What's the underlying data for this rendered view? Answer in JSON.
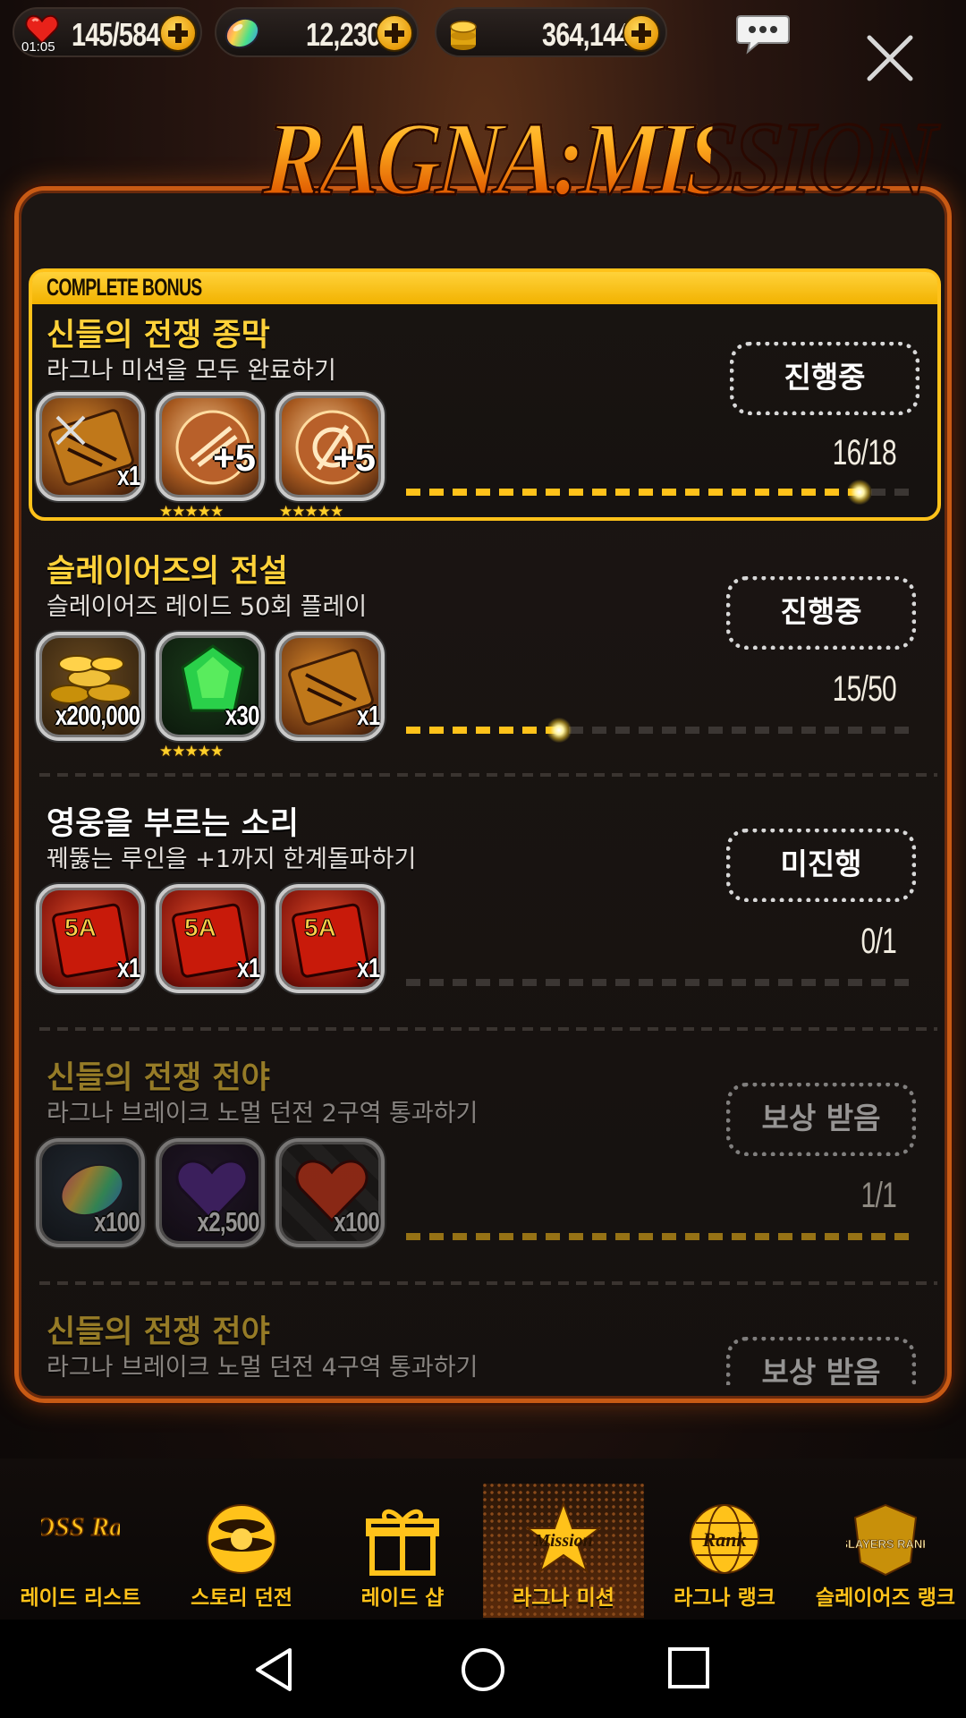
{
  "topbar": {
    "stamina": "145/584",
    "stamina_timer": "01:05",
    "gems": "12,230",
    "gold": "364,144"
  },
  "title": "Ragna:Mission",
  "complete_bonus_label": "COMPLETE BONUS",
  "missions": [
    {
      "title": "신들의 전쟁 종막",
      "desc": "라그나 미션을 모두 완료하기",
      "status": "진행중",
      "progress_text": "16/18",
      "progress": 0.889,
      "rewards": [
        {
          "icon": "ticket-icon",
          "qty": "x1"
        },
        {
          "icon": "rune-orb-icon",
          "plus": "+5",
          "stars": "★★★★★"
        },
        {
          "icon": "rune-orb-icon",
          "plus": "+5",
          "stars": "★★★★★"
        }
      ]
    },
    {
      "title": "슬레이어즈의 전설",
      "desc": "슬레이어즈 레이드 50회 플레이",
      "status": "진행중",
      "progress_text": "15/50",
      "progress": 0.3,
      "rewards": [
        {
          "icon": "gold-coins-icon",
          "qty": "x200,000"
        },
        {
          "icon": "green-gem-icon",
          "qty": "x30",
          "stars": "★★★★★"
        },
        {
          "icon": "ticket-icon",
          "qty": "x1"
        }
      ]
    },
    {
      "title": "영웅을 부르는 소리",
      "desc": "꿰뚫는 루인을 +1까지 한계돌파하기",
      "status": "미진행",
      "progress_text": "0/1",
      "progress": 0,
      "rewards": [
        {
          "icon": "card-pack-icon",
          "qty": "x1"
        },
        {
          "icon": "card-pack-icon",
          "qty": "x1"
        },
        {
          "icon": "card-pack-icon",
          "qty": "x1"
        }
      ]
    },
    {
      "title": "신들의 전쟁 전야",
      "desc": "라그나 브레이크 노멀 던전 2구역 통과하기",
      "status": "보상 받음",
      "progress_text": "1/1",
      "progress": 1,
      "rewards": [
        {
          "icon": "rainbow-gem-icon",
          "qty": "x100"
        },
        {
          "icon": "purple-heart-icon",
          "qty": "x2,500"
        },
        {
          "icon": "red-heart-icon",
          "qty": "x100"
        }
      ]
    },
    {
      "title": "신들의 전쟁 전야",
      "desc": "라그나 브레이크 노멀 던전 4구역 통과하기",
      "status": "보상 받음"
    }
  ],
  "nav": [
    {
      "label": "레이드 리스트",
      "icon": "boss-raid-icon"
    },
    {
      "label": "스토리 던전",
      "icon": "story-orb-icon"
    },
    {
      "label": "레이드 샵",
      "icon": "gift-icon"
    },
    {
      "label": "라그나 미션",
      "icon": "mission-star-icon",
      "active": true
    },
    {
      "label": "라그나 랭크",
      "icon": "rank-globe-icon"
    },
    {
      "label": "슬레이어즈 랭크",
      "icon": "slayers-rank-icon"
    }
  ],
  "nav_logo_text": {
    "boss_raid": "BOSS Raid",
    "mission": "Mission",
    "rank": "Rank",
    "slayers_rank": "SLAYERS RANK"
  },
  "colors": {
    "accent": "#ffc21a",
    "panel_border": "#c85a14",
    "title_yellow": "#ffd23a"
  }
}
